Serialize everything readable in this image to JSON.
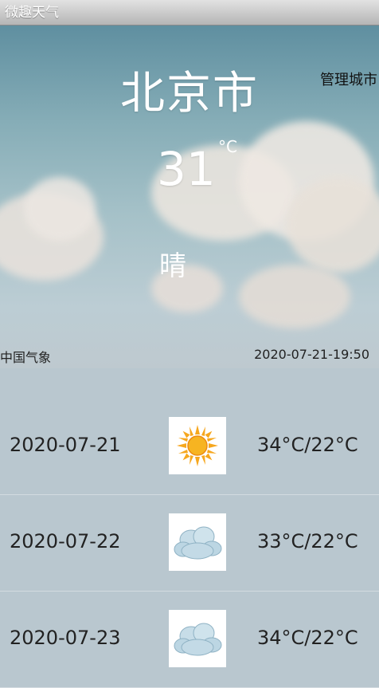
{
  "window": {
    "title": "微趣天气"
  },
  "current": {
    "city": "北京市",
    "manage_label": "管理城市",
    "temperature": "31",
    "unit": "°C",
    "condition": "晴",
    "source": "中国气象",
    "updated": "2020-07-21-19:50"
  },
  "forecast": [
    {
      "date": "2020-07-21",
      "icon": "sunny-icon",
      "range": "34°C/22°C"
    },
    {
      "date": "2020-07-22",
      "icon": "cloudy-icon",
      "range": "33°C/22°C"
    },
    {
      "date": "2020-07-23",
      "icon": "cloudy-icon",
      "range": "34°C/22°C"
    }
  ],
  "colors": {
    "sun": "#f6a71e",
    "cloud": "#b9d3e0",
    "sky": "#86adb7"
  }
}
